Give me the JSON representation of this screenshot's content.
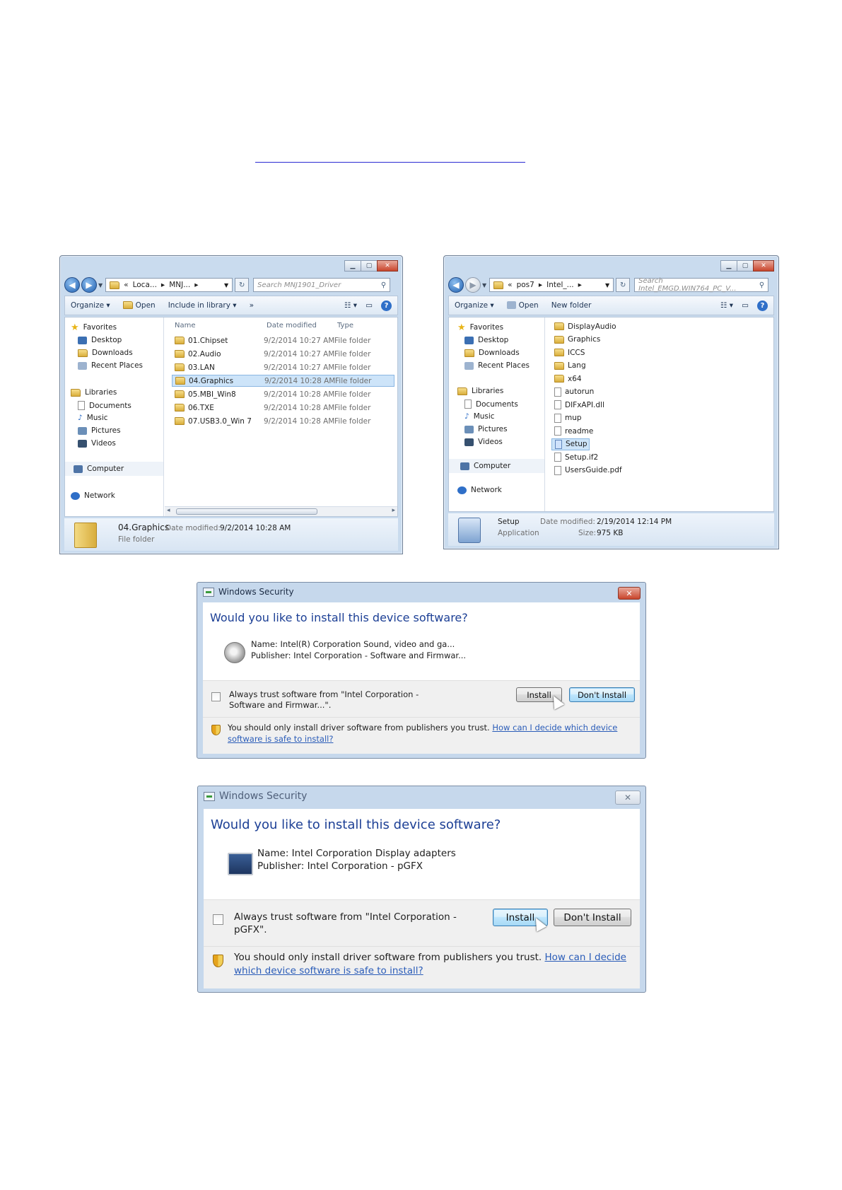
{
  "explorer_left": {
    "address": {
      "overflow": "«",
      "crumb1": "Loca...",
      "crumb2": "MNJ..."
    },
    "search_placeholder": "Search MNJ1901_Driver",
    "toolbar": {
      "organize": "Organize",
      "open": "Open",
      "include": "Include in library",
      "more": "»"
    },
    "nav": {
      "favorites": "Favorites",
      "desktop": "Desktop",
      "downloads": "Downloads",
      "recent": "Recent Places",
      "libraries": "Libraries",
      "documents": "Documents",
      "music": "Music",
      "pictures": "Pictures",
      "videos": "Videos",
      "computer": "Computer",
      "network": "Network"
    },
    "columns": {
      "name": "Name",
      "date": "Date modified",
      "type": "Type"
    },
    "rows": [
      {
        "name": "01.Chipset",
        "date": "9/2/2014 10:27 AM",
        "type": "File folder"
      },
      {
        "name": "02.Audio",
        "date": "9/2/2014 10:27 AM",
        "type": "File folder"
      },
      {
        "name": "03.LAN",
        "date": "9/2/2014 10:27 AM",
        "type": "File folder"
      },
      {
        "name": "04.Graphics",
        "date": "9/2/2014 10:28 AM",
        "type": "File folder"
      },
      {
        "name": "05.MBI_Win8",
        "date": "9/2/2014 10:28 AM",
        "type": "File folder"
      },
      {
        "name": "06.TXE",
        "date": "9/2/2014 10:28 AM",
        "type": "File folder"
      },
      {
        "name": "07.USB3.0_Win 7",
        "date": "9/2/2014 10:28 AM",
        "type": "File folder"
      }
    ],
    "selected_row": "04.Graphics",
    "details": {
      "name": "04.Graphics",
      "date_label": "Date modified:",
      "date": "9/2/2014 10:28 AM",
      "kind": "File folder"
    }
  },
  "explorer_right": {
    "address": {
      "overflow": "«",
      "crumb1": "pos7",
      "crumb2": "Intel_..."
    },
    "search_placeholder": "Search Intel_EMGD.WIN764_PC_V...",
    "toolbar": {
      "organize": "Organize",
      "open": "Open",
      "newfolder": "New folder"
    },
    "nav": {
      "favorites": "Favorites",
      "desktop": "Desktop",
      "downloads": "Downloads",
      "recent": "Recent Places",
      "libraries": "Libraries",
      "documents": "Documents",
      "music": "Music",
      "pictures": "Pictures",
      "videos": "Videos",
      "computer": "Computer",
      "network": "Network"
    },
    "files": [
      {
        "name": "DisplayAudio",
        "kind": "folder"
      },
      {
        "name": "Graphics",
        "kind": "folder"
      },
      {
        "name": "ICCS",
        "kind": "folder"
      },
      {
        "name": "Lang",
        "kind": "folder"
      },
      {
        "name": "x64",
        "kind": "folder"
      },
      {
        "name": "autorun",
        "kind": "file"
      },
      {
        "name": "DIFxAPI.dll",
        "kind": "file"
      },
      {
        "name": "mup",
        "kind": "file"
      },
      {
        "name": "readme",
        "kind": "file"
      },
      {
        "name": "Setup",
        "kind": "setup"
      },
      {
        "name": "Setup.if2",
        "kind": "file"
      },
      {
        "name": "UsersGuide.pdf",
        "kind": "file"
      }
    ],
    "selected_file": "Setup",
    "details": {
      "name": "Setup",
      "kind": "Application",
      "date_label": "Date modified:",
      "date": "2/19/2014 12:14 PM",
      "size_label": "Size:",
      "size": "975 KB"
    }
  },
  "dialog_audio": {
    "title": "Windows Security",
    "heading": "Would you like to install this device software?",
    "name_line": "Name: Intel(R) Corporation Sound, video and ga...",
    "publisher_line": "Publisher: Intel Corporation - Software and Firmwar...",
    "trust_line1": "Always trust software from \"Intel Corporation -",
    "trust_line2": "Software and Firmwar...\".",
    "install": "Install",
    "dont_install": "Don't Install",
    "warning": "You should only install driver software from publishers you trust.",
    "link1": "How can I decide which device software is",
    "link2": "safe to install?"
  },
  "dialog_graphics": {
    "title": "Windows Security",
    "heading": "Would you like to install this device software?",
    "name_line": "Name: Intel Corporation Display adapters",
    "publisher_line": "Publisher: Intel Corporation - pGFX",
    "trust_line1": "Always trust software from \"Intel Corporation -",
    "trust_line2": "pGFX\".",
    "install": "Install",
    "dont_install": "Don't Install",
    "warning": "You should only install driver software from publishers you trust.",
    "link1": "How can I decide which",
    "link2": "device software is safe to install?"
  },
  "colors": {
    "link": "#2a5cb8",
    "heading": "#1c3f95",
    "chrome": "#c9dbee",
    "selection": "#cde4f9"
  }
}
